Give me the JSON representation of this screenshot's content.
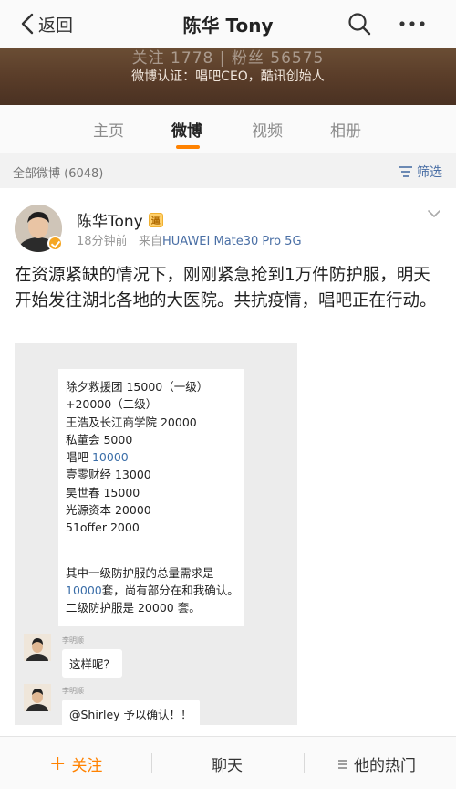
{
  "nav": {
    "back_label": "返回",
    "title": "陈华 Tony"
  },
  "banner": {
    "stats": "关注  1778   |   粉丝  56575",
    "verification": "微博认证：唱吧CEO，酷讯创始人"
  },
  "tabs": [
    {
      "label": "主页",
      "active": false
    },
    {
      "label": "微博",
      "active": true
    },
    {
      "label": "视频",
      "active": false
    },
    {
      "label": "相册",
      "active": false
    }
  ],
  "filterbar": {
    "count_label": "全部微博 (6048)",
    "filter_label": "筛选"
  },
  "post": {
    "author": "陈华Tony",
    "member_badge": "逼",
    "time": "18分钟前",
    "source_prefix": "来自",
    "source": "HUAWEI Mate30 Pro 5G",
    "text": "在资源紧缺的情况下，刚刚紧急抢到1万件防护服，明天开始发往湖北各地的大医院。共抗疫情，唱吧正在行动。"
  },
  "chat": {
    "main_lines": [
      "除夕救援团 15000（一级）",
      "+20000（二级）",
      "王浩及长江商学院 20000",
      "私董会 5000",
      "唱吧 ",
      "壹零财经 13000",
      "吴世春 15000",
      "光源资本 20000",
      "51offer 2000"
    ],
    "changba_value": "10000",
    "summary_line1": "其中一级防护服的总量需求是",
    "summary_value": "10000",
    "summary_line2_rest": "套，尚有部分在和我确认。",
    "summary_line3": "二级防护服是 20000 套。",
    "sender_name": "李明顺",
    "message1": "这样呢？",
    "message2": "@Shirley 予以确认！！"
  },
  "toolbar": {
    "follow_label": "关注",
    "chat_label": "聊天",
    "hot_label": "他的热门"
  },
  "colors": {
    "accent": "#ff8200",
    "link": "#4a6fa5",
    "banner": "#5a3d29"
  }
}
